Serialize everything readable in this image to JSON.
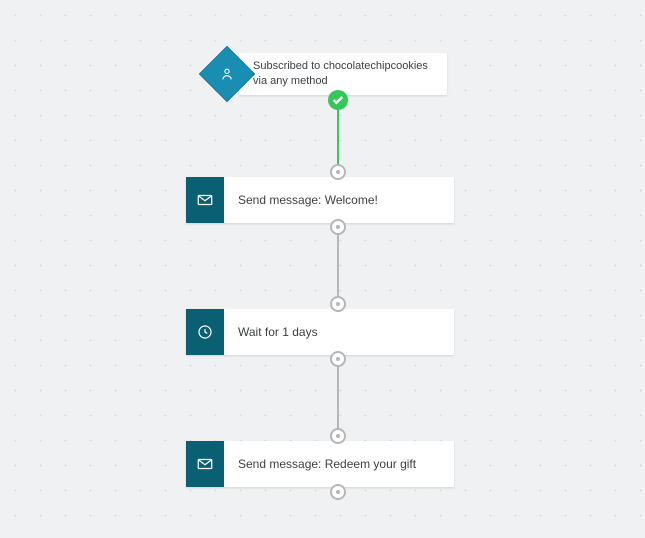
{
  "trigger": {
    "label": "Subscribed to chocolatechipcookies via any method"
  },
  "steps": [
    {
      "icon": "mail",
      "label": "Send message: Welcome!"
    },
    {
      "icon": "clock",
      "label": "Wait for 1 days"
    },
    {
      "icon": "mail",
      "label": "Send message: Redeem your gift"
    }
  ],
  "colors": {
    "brand_dark": "#0b5f73",
    "brand_light": "#1a8db3",
    "success": "#34c759"
  }
}
